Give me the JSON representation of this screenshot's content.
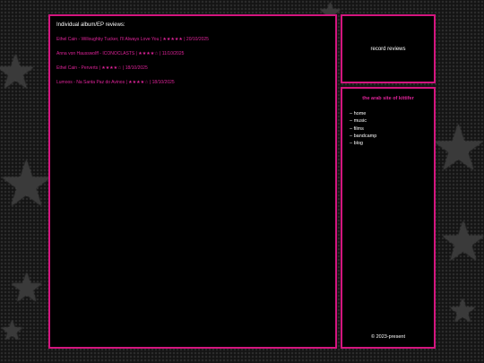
{
  "main": {
    "heading": "Individual album/EP reviews:",
    "reviews": [
      "Ethel Cain - Willoughby Tucker, I'll Always Love You | ★★★★★ | 20/10/2025",
      "Anna von Hausswolff - ICONOCLASTS | ★★★★☆ | 11/10/2025",
      "Ethel Cain - Perverts | ★★★★☆ | 18/10/2025",
      "Lumoos - Na Santa Paz do Avinos | ★★★★☆ | 18/10/2025"
    ]
  },
  "sidebar": {
    "top_label": "record reviews",
    "site_name": "the arab site of kittifer",
    "nav": [
      "– home",
      "– music",
      "– films",
      "– bandcamp",
      "– blog"
    ],
    "footer": "© 2023-present"
  },
  "colors": {
    "accent": "#d4157f",
    "panel_bg": "#000000"
  }
}
